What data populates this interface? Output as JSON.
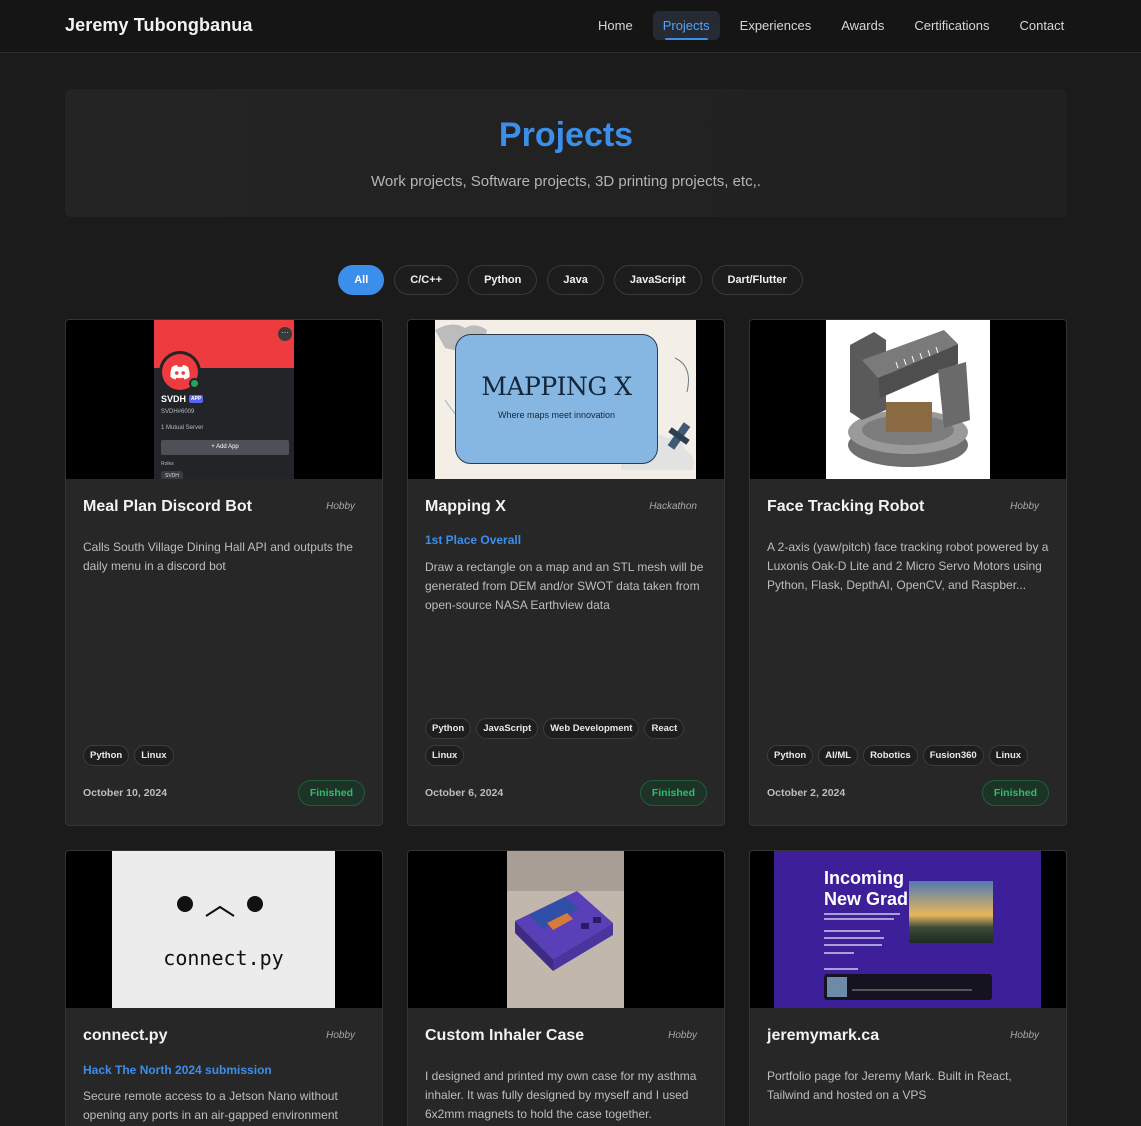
{
  "nav": {
    "brand": "Jeremy Tubongbanua",
    "links": [
      "Home",
      "Projects",
      "Experiences",
      "Awards",
      "Certifications",
      "Contact"
    ],
    "active": "Projects"
  },
  "hero": {
    "title": "Projects",
    "subtitle": "Work projects, Software projects, 3D printing projects, etc,."
  },
  "filters": [
    "All",
    "C/C++",
    "Python",
    "Java",
    "JavaScript",
    "Dart/Flutter"
  ],
  "active_filter": "All",
  "projects": [
    {
      "title": "Meal Plan Discord Bot",
      "category": "Hobby",
      "description": "Calls South Village Dining Hall API and outputs the daily menu in a discord bot",
      "tags": [
        "Python",
        "Linux"
      ],
      "date": "October 10, 2024",
      "status": "Finished",
      "thumb": {
        "name": "SVDH",
        "app_badge": "APP",
        "handle": "SVDH#6009",
        "mutual": "1 Mutual Server",
        "add_app": "+ Add App",
        "roles": "Roles",
        "role": "SVDH"
      }
    },
    {
      "title": "Mapping X",
      "category": "Hackathon",
      "award": "1st Place Overall",
      "description": "Draw a rectangle on a map and an STL mesh will be generated from DEM and/or SWOT data taken from open-source NASA Earthview data",
      "tags": [
        "Python",
        "JavaScript",
        "Web Development",
        "React",
        "Linux"
      ],
      "date": "October 6, 2024",
      "status": "Finished",
      "thumb": {
        "title": "MAPPING X",
        "tagline": "Where maps meet innovation"
      }
    },
    {
      "title": "Face Tracking Robot",
      "category": "Hobby",
      "description": "A 2-axis (yaw/pitch) face tracking robot powered by a Luxonis Oak-D Lite and 2 Micro Servo Motors using Python, Flask, DepthAI, OpenCV, and Raspber...",
      "tags": [
        "Python",
        "AI/ML",
        "Robotics",
        "Fusion360",
        "Linux"
      ],
      "date": "October 2, 2024",
      "status": "Finished"
    },
    {
      "title": "connect.py",
      "category": "Hobby",
      "award": "Hack The North 2024 submission",
      "description": "Secure remote access to a Jetson Nano without opening any ports in an air-gapped environment",
      "thumb": {
        "face": "• ‿ •",
        "text": "connect.py"
      }
    },
    {
      "title": "Custom Inhaler Case",
      "category": "Hobby",
      "description": "I designed and printed my own case for my asthma inhaler. It was fully designed by myself and I used 6x2mm magnets to hold the case together."
    },
    {
      "title": "jeremymark.ca",
      "category": "Hobby",
      "description": "Portfolio page for Jeremy Mark. Built in React, Tailwind and hosted on a VPS",
      "thumb": {
        "heading_line1": "Incoming",
        "heading_line2": "New Grad"
      }
    }
  ]
}
